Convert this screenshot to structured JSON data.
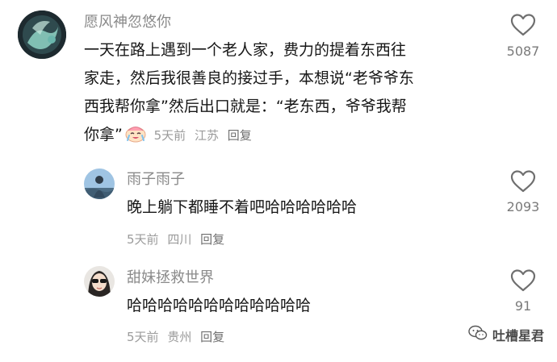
{
  "comments": [
    {
      "username": "愿风神忽悠你",
      "lines": [
        "一天在路上遇到一个老人家，费力的提着东西往",
        "家走，然后我很善良的接过手，本想说“老爷爷东",
        "西我帮你拿”然后出口就是：“老东西，爷爷我帮",
        "你拿”"
      ],
      "emoji": "laughing-cry-emoji",
      "time": "5天前",
      "location": "江苏",
      "reply_label": "回复",
      "like_count": "5087"
    },
    {
      "username": "雨子雨子",
      "lines": [
        "晚上躺下都睡不着吧哈哈哈哈哈哈"
      ],
      "time": "5天前",
      "location": "四川",
      "reply_label": "回复",
      "like_count": "2093"
    },
    {
      "username": "甜妹拯救世界",
      "lines": [
        "哈哈哈哈哈哈哈哈哈哈哈哈"
      ],
      "time": "5天前",
      "location": "贵州",
      "reply_label": "回复",
      "like_count": "91"
    }
  ],
  "watermark": {
    "text": "吐槽星君",
    "icon": "wechat-icon"
  },
  "colors": {
    "username": "#8a8a8a",
    "text": "#161616",
    "meta": "#9b9b9b",
    "icon": "#6f6f6f"
  }
}
